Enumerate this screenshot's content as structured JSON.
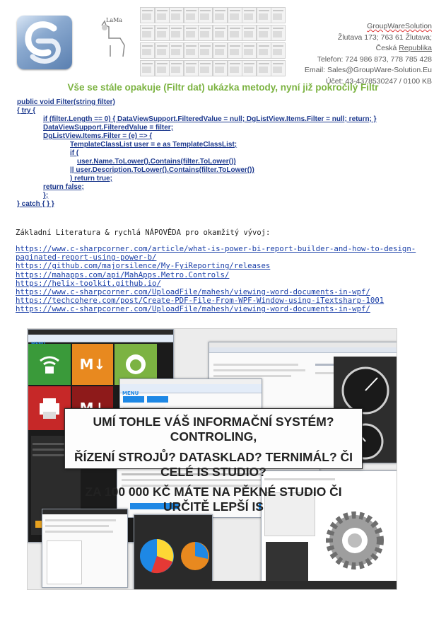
{
  "header": {
    "company_name": "GroupWareSolution",
    "address_line1": "Žlutava 173; 763 61 Žlutava;",
    "country_prefix": "Česká ",
    "country_suffix": "Republika",
    "phone": "Telefon: 724 986 873, 778 785 428",
    "email": "Email: Sales@GroupWare-Solution.Eu",
    "account": "Účet: 43-4378530247 / 0100 KB",
    "logo_text": "GS",
    "lama_text": "LaMa"
  },
  "title": "Vše se stále opakuje (Filtr dat) ukázka metody, nyní již pokročilý Filtr",
  "code": {
    "l1": "public void Filter(string filter)",
    "l2": "{ try {",
    "l3": "if (filter.Length == 0) { DataViewSupport.FilteredValue = null; DgListView.Items.Filter = null; return; }",
    "l4": "DataViewSupport.FilteredValue = filter;",
    "l5": "DgListView.Items.Filter = (e) => {",
    "l6": "TemplateClassList user = e as TemplateClassList;",
    "l7": "if (",
    "l8": "user.Name.ToLower().Contains(filter.ToLower())",
    "l9": "|| user.Description.ToLower().Contains(filter.ToLower())",
    "l10": ") return true;",
    "l11": "return false;",
    "l12": "};",
    "l13": "} catch { } }"
  },
  "literature": {
    "heading": "Základní Literatura & rychlá NÁPOVĚDA pro okamžitý vývoj:",
    "links": [
      "https://www.c-sharpcorner.com/article/what-is-power-bi-report-builder-and-how-to-design-",
      "paginated-report-using-power-b/",
      "https://github.com/majorsilence/My-FyiReporting/releases",
      "https://mahapps.com/api/MahApps.Metro.Controls/",
      "https://helix-toolkit.github.io/",
      "https://www.c-sharpcorner.com/UploadFile/mahesh/viewing-word-documents-in-wpf/",
      "https://techcohere.com/post/Create-PDF-File-From-WPF-Window-using-iTextsharp-1001",
      "https://www.c-sharpcorner.com/UploadFile/mahesh/viewing-word-documents-in-wpf/"
    ]
  },
  "collage": {
    "banner_line1": "UMÍ TOHLE VÁŠ INFORMAČNÍ SYSTÉM? CONTROLING,",
    "banner_line2": "ŘÍZENÍ STROJŮ? DATASKLAD? TERNIMÁL? ČI CELÉ IS STUDIO?",
    "banner_line3": "ZA 100 000 KČ MÁTE NA PĚKNÉ STUDIO ČI URČITĚ LEPŠÍ IS",
    "menu_label": "MENU",
    "tile_md": "M↓",
    "colors": {
      "tile_green": "#3a9a3a",
      "tile_orange": "#e8891f",
      "tile_lime": "#7cb342",
      "tile_red": "#c62828",
      "tile_darkred": "#8e1a1a",
      "accent_blue": "#1e88e5"
    }
  }
}
